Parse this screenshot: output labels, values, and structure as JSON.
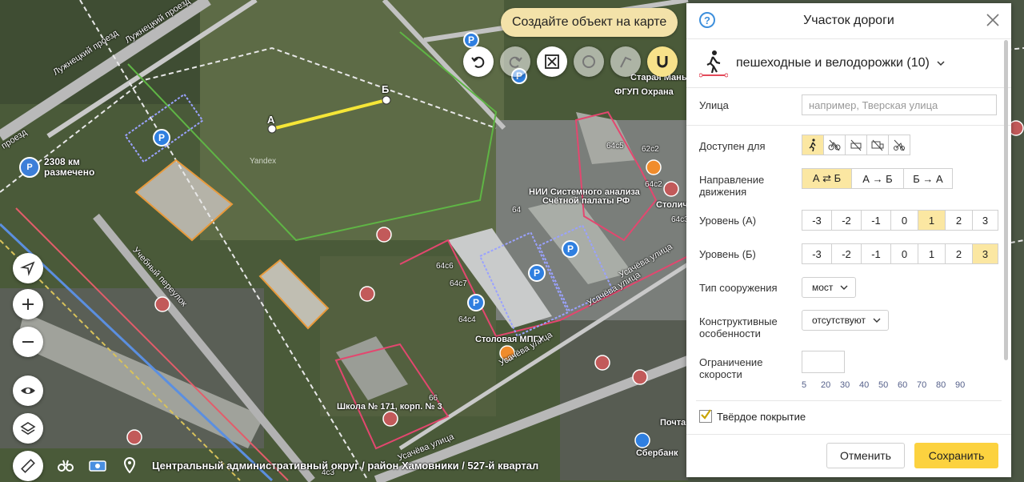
{
  "map": {
    "create_object_button": "Создайте объект на карте",
    "distance": {
      "icon": "parking-flag-icon",
      "icon_text": "P",
      "line1": "2308 км",
      "line2": "размечено"
    },
    "point_a": "А",
    "point_b": "Б",
    "address": "Центральный административный округ / район Хамовники / 527-й квартал",
    "watermark": "Yandex",
    "labels": {
      "luzhnetsky1": "Лужнецкий проезд",
      "luzhnetsky2": "Лужнецкий проезд",
      "proezd": "проезд",
      "uchebny": "Учебный переулок",
      "usacheva1": "Усачёва улица",
      "usacheva2": "Усачёва улица",
      "usacheva3": "Усачёва улица",
      "usacheva4": "Усачёва улица",
      "staraya": "Старая Мань",
      "fgup": "ФГУП Охрана",
      "nii1": "НИИ Системного анализа",
      "nii2": "Счётной палаты РФ",
      "stolovaya": "Столовая МПГУ",
      "school": "Школа № 171, корп. № 3",
      "sberbank": "Сбербанк",
      "pochta": "Почта",
      "stolich": "Столич",
      "b64c5": "64с5",
      "b62c2": "62с2",
      "b64c2": "64с2",
      "b64c3": "64с3",
      "b64": "64",
      "b64c6": "64с6",
      "b64c7": "64с7",
      "b64c4": "64с4",
      "b66": "66",
      "b4c3": "4с3"
    }
  },
  "panel": {
    "title": "Участок дороги",
    "help_icon_text": "?",
    "type_label": "пешеходные и велодорожки (10)",
    "street": {
      "label": "Улица",
      "placeholder": "например, Тверская улица"
    },
    "access": {
      "label": "Доступен для",
      "icons": [
        "pedestrian-icon",
        "bicycle-icon",
        "car-off-icon",
        "truck-off-icon",
        "scooter-off-icon"
      ]
    },
    "direction": {
      "label1": "Направление",
      "label2": "движения",
      "options": [
        "А ⇄ Б",
        "А → Б",
        "Б → А"
      ],
      "selected": 0
    },
    "level_a": {
      "label": "Уровень (А)",
      "options": [
        "-3",
        "-2",
        "-1",
        "0",
        "1",
        "2",
        "3"
      ],
      "selected": 4
    },
    "level_b": {
      "label": "Уровень (Б)",
      "options": [
        "-3",
        "-2",
        "-1",
        "0",
        "1",
        "2",
        "3"
      ],
      "selected": 6
    },
    "structure": {
      "label": "Тип сооружения",
      "value": "мост"
    },
    "constructive": {
      "label1": "Конструктивные",
      "label2": "особенности",
      "value": "отсутствуют"
    },
    "speed": {
      "label1": "Ограничение",
      "label2": "скорости",
      "presets": [
        "5",
        "20",
        "30",
        "40",
        "50",
        "60",
        "70",
        "80",
        "90"
      ]
    },
    "hard_surface": {
      "label": "Твёрдое покрытие",
      "checked": true
    },
    "cancel": "Отменить",
    "save": "Сохранить"
  },
  "colors": {
    "accent": "#fcd23f",
    "selected": "#fbe7a2",
    "link": "#3d8fdc"
  }
}
